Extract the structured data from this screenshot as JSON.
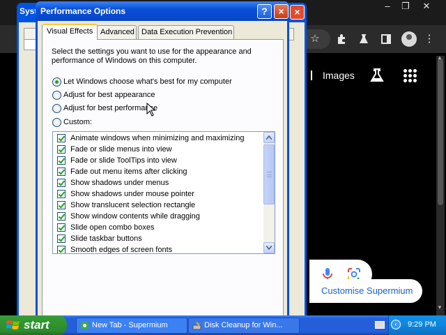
{
  "browser": {
    "link_images": "Images",
    "customise_label": "Customise Supermium"
  },
  "sysprops": {
    "title_fragment": "Syst"
  },
  "dialog": {
    "title": "Performance Options",
    "help_label": "?",
    "close_label": "×",
    "tabs": [
      {
        "label": "Visual Effects",
        "active": true
      },
      {
        "label": "Advanced",
        "active": false
      },
      {
        "label": "Data Execution Prevention",
        "active": false
      }
    ],
    "intro": "Select the settings you want to use for the appearance and performance of Windows on this computer.",
    "radios": [
      {
        "label": "Let Windows choose what's best for my computer",
        "selected": true
      },
      {
        "label": "Adjust for best appearance",
        "selected": false
      },
      {
        "label": "Adjust for best performance",
        "selected": false
      },
      {
        "label": "Custom:",
        "selected": false
      }
    ],
    "effects": [
      "Animate windows when minimizing and maximizing",
      "Fade or slide menus into view",
      "Fade or slide ToolTips into view",
      "Fade out menu items after clicking",
      "Show shadows under menus",
      "Show shadows under mouse pointer",
      "Show translucent selection rectangle",
      "Show window contents while dragging",
      "Slide open combo boxes",
      "Slide taskbar buttons",
      "Smooth edges of screen fonts"
    ]
  },
  "taskbar": {
    "start_label": "start",
    "tasks": [
      {
        "label": "New Tab - Supermium",
        "icon": "supermium-icon"
      },
      {
        "label": "Disk Cleanup for Win...",
        "icon": "disk-cleanup-icon"
      }
    ],
    "clock": "9:29 PM"
  },
  "colors": {
    "xp_blue": "#0a4fd8",
    "start_green": "#319931",
    "check_green": "#21a121"
  }
}
